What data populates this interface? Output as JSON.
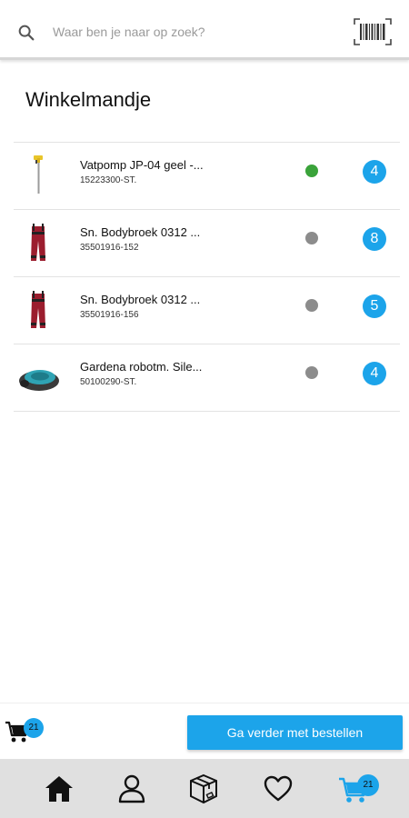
{
  "search": {
    "placeholder": "Waar ben je naar op zoek?",
    "value": ""
  },
  "page": {
    "title": "Winkelmandje"
  },
  "cart": {
    "items": [
      {
        "name": "Vatpomp JP-04 geel -...",
        "sku": "15223300-ST.",
        "quantity": "4",
        "status_color": "#3aa33a"
      },
      {
        "name": "Sn. Bodybroek 0312 ...",
        "sku": "35501916-152",
        "quantity": "8",
        "status_color": "#8c8c8c"
      },
      {
        "name": "Sn. Bodybroek 0312 ...",
        "sku": "35501916-156",
        "quantity": "5",
        "status_color": "#8c8c8c"
      },
      {
        "name": "Gardena robotm. Sile...",
        "sku": "50100290-ST.",
        "quantity": "4",
        "status_color": "#8c8c8c"
      }
    ]
  },
  "checkout": {
    "cart_count": "21",
    "order_button_label": "Ga verder met bestellen"
  },
  "nav": {
    "items": [
      "home-icon",
      "profile-icon",
      "package-icon",
      "heart-icon",
      "cart-icon"
    ],
    "cart_count": "21"
  },
  "colors": {
    "accent": "#1ca4ea",
    "in_stock": "#3aa33a",
    "unknown_stock": "#8c8c8c",
    "nav_background": "#e0e0e0"
  }
}
